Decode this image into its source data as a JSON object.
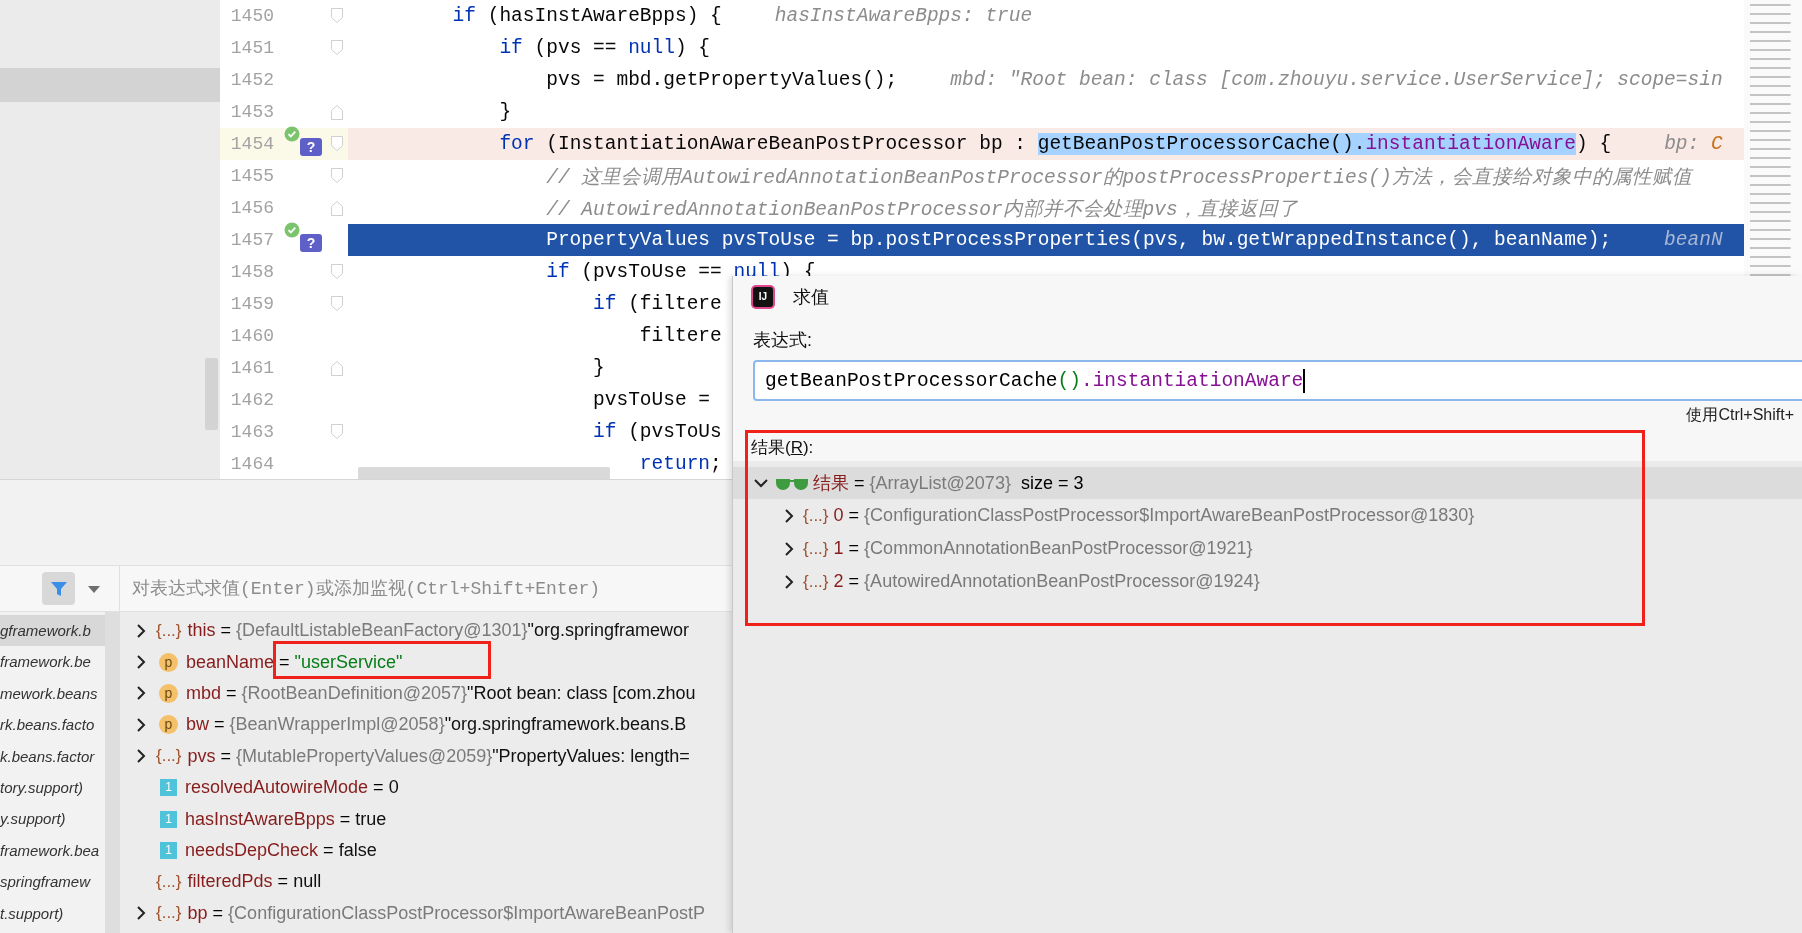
{
  "left_panel": {
    "rows": [
      {
        "selected": true
      }
    ]
  },
  "editor": {
    "lines": [
      {
        "number": "1450",
        "fold_open": true,
        "tokens": [
          {
            "kind": "kw",
            "text": "if"
          },
          {
            "kind": "plain",
            "text": " (hasInstAwareBpps) {"
          }
        ],
        "hint": [
          {
            "kind": "hint",
            "text": "hasInstAwareBpps: true"
          }
        ],
        "children": [
          {
            "number": "1451",
            "fold_open": true,
            "tokens": [
              {
                "kind": "kw",
                "text": "if"
              },
              {
                "kind": "plain",
                "text": " (pvs == "
              },
              {
                "kind": "kw",
                "text": "null"
              },
              {
                "kind": "plain",
                "text": ") {"
              }
            ],
            "children": [
              {
                "number": "1452",
                "tokens": [
                  {
                    "kind": "plain",
                    "text": "pvs = mbd.getPropertyValues();"
                  }
                ],
                "hint": [
                  {
                    "kind": "hint",
                    "text": "mbd: \"Root bean: class [com.zhouyu.service.UserService]; scope=sin"
                  }
                ]
              }
            ]
          },
          {
            "number": "1453",
            "fold_open": false,
            "tokens": [
              {
                "kind": "plain",
                "text": "}"
              }
            ]
          },
          {
            "number": "1454",
            "fold_open": true,
            "breakpoint": true,
            "current": false,
            "marker": "?",
            "tokens": [
              {
                "kind": "kw",
                "text": "for"
              },
              {
                "kind": "plain",
                "text": " (InstantiationAwareBeanPostProcessor bp : "
              },
              {
                "kind": "plain",
                "text": "getBeanPostProcessorCache().",
                "selected": true
              },
              {
                "kind": "field",
                "text": "instantiationAware",
                "selected": true
              },
              {
                "kind": "plain",
                "text": ") {"
              }
            ],
            "hint": [
              {
                "kind": "hint",
                "text": "bp: "
              },
              {
                "kind": "hint_ref",
                "text": "C"
              }
            ],
            "children": [
              {
                "number": "1455",
                "fold_open": true,
                "tokens": [
                  {
                    "kind": "comment",
                    "text": "// 这里会调用AutowiredAnnotationBeanPostProcessor的postProcessProperties()方法，会直接给对象中的属性赋值"
                  }
                ]
              },
              {
                "number": "1456",
                "fold_open": false,
                "tokens": [
                  {
                    "kind": "comment",
                    "text": "// AutowiredAnnotationBeanPostProcessor内部并不会处理pvs，直接返回了"
                  }
                ]
              },
              {
                "number": "1457",
                "breakpoint": true,
                "current": true,
                "marker": "?",
                "tokens": [
                  {
                    "kind": "plain",
                    "text": "PropertyValues pvsToUse = bp.postProcessProperties(pvs, bw.getWrappedInstance(), beanName);"
                  }
                ],
                "hint": [
                  {
                    "kind": "hint",
                    "text": "beanN"
                  }
                ]
              },
              {
                "number": "1458",
                "fold_open": true,
                "tokens": [
                  {
                    "kind": "kw",
                    "text": "if"
                  },
                  {
                    "kind": "plain",
                    "text": " (pvsToUse == "
                  },
                  {
                    "kind": "kw",
                    "text": "null"
                  },
                  {
                    "kind": "plain",
                    "text": ") {"
                  }
                ],
                "children": [
                  {
                    "number": "1459",
                    "fold_open": true,
                    "tokens": [
                      {
                        "kind": "kw",
                        "text": "if"
                      },
                      {
                        "kind": "plain",
                        "text": " (filtere"
                      }
                    ],
                    "children": [
                      {
                        "number": "1460",
                        "tokens": [
                          {
                            "kind": "plain",
                            "text": "filtere"
                          }
                        ]
                      }
                    ]
                  },
                  {
                    "number": "1461",
                    "fold_open": false,
                    "tokens": [
                      {
                        "kind": "plain",
                        "text": "}"
                      }
                    ]
                  },
                  {
                    "number": "1462",
                    "tokens": [
                      {
                        "kind": "plain",
                        "text": "pvsToUse ="
                      }
                    ]
                  },
                  {
                    "number": "1463",
                    "fold_open": true,
                    "tokens": [
                      {
                        "kind": "kw",
                        "text": "if"
                      },
                      {
                        "kind": "plain",
                        "text": " (pvsToUs"
                      }
                    ],
                    "children": [
                      {
                        "number": "1464",
                        "tokens": [
                          {
                            "kind": "kw",
                            "text": "return"
                          },
                          {
                            "kind": "plain",
                            "text": ";"
                          }
                        ]
                      }
                    ]
                  }
                ]
              }
            ]
          }
        ]
      }
    ]
  },
  "debugger": {
    "watch_placeholder": "对表达式求值(Enter)或添加监视(Ctrl+Shift+Enter)",
    "frames": [
      {
        "text": "gframework.b",
        "selected": true
      },
      {
        "text": "framework.be",
        "selected": false
      },
      {
        "text": "mework.beans",
        "selected": false
      },
      {
        "text": "rk.beans.facto",
        "selected": false
      },
      {
        "text": "k.beans.factor",
        "selected": false
      },
      {
        "text": "tory.support)",
        "selected": false
      },
      {
        "text": "y.support)",
        "selected": false
      },
      {
        "text": "framework.bea",
        "selected": false
      },
      {
        "text": "springframew",
        "selected": false
      },
      {
        "text": "t.support)",
        "selected": false
      }
    ],
    "variables": [
      {
        "kind": "object",
        "badge": "{...}",
        "expandable": true,
        "name": "this",
        "op": "=",
        "ref": "{DefaultListableBeanFactory@1301}",
        "value": "\"org.springframewor",
        "string": false
      },
      {
        "kind": "param",
        "badge": "p",
        "expandable": true,
        "name": "beanName",
        "op": "=",
        "value": "\"userService\"",
        "string": true
      },
      {
        "kind": "param",
        "badge": "p",
        "expandable": true,
        "name": "mbd",
        "op": "=",
        "ref": "{RootBeanDefinition@2057}",
        "value": "\"Root bean: class [com.zhou",
        "string": false
      },
      {
        "kind": "param",
        "badge": "p",
        "expandable": true,
        "name": "bw",
        "op": "=",
        "ref": "{BeanWrapperImpl@2058}",
        "value": "\"org.springframework.beans.B",
        "string": false
      },
      {
        "kind": "object",
        "badge": "{...}",
        "expandable": true,
        "name": "pvs",
        "op": "=",
        "ref": "{MutablePropertyValues@2059}",
        "value": "\"PropertyValues: length=",
        "string": false
      },
      {
        "kind": "primitive",
        "badge": "1",
        "expandable": false,
        "name": "resolvedAutowireMode",
        "op": "=",
        "value": "0",
        "string": false
      },
      {
        "kind": "primitive",
        "badge": "1",
        "expandable": false,
        "name": "hasInstAwareBpps",
        "op": "=",
        "value": "true",
        "string": false
      },
      {
        "kind": "primitive",
        "badge": "1",
        "expandable": false,
        "name": "needsDepCheck",
        "op": "=",
        "value": "false",
        "string": false
      },
      {
        "kind": "object",
        "badge": "{...}",
        "expandable": false,
        "name": "filteredPds",
        "op": "=",
        "value": "null",
        "string": false
      },
      {
        "kind": "object",
        "badge": "{...}",
        "expandable": true,
        "name": "bp",
        "op": "=",
        "ref": "{ConfigurationClassPostProcessor$ImportAwareBeanPostP"
      }
    ]
  },
  "dialog": {
    "logo": "IJ",
    "title": "求值",
    "expression_label": "表达式:",
    "expression": [
      {
        "kind": "plain",
        "text": "getBeanPostProcessorCache"
      },
      {
        "kind": "paren",
        "text": "()"
      },
      {
        "kind": "field",
        "text": ".instantiationAware"
      }
    ],
    "shortcut_hint": "使用Ctrl+Shift+",
    "result_label": {
      "before": "结果(",
      "mnemonic": "R",
      "after": "):"
    },
    "result": {
      "name": "结果",
      "op": "=",
      "ref": "{ArrayList@2073}",
      "extra": "size = 3",
      "expanded": true,
      "selected": true,
      "children": [
        {
          "badge": "{...}",
          "name": "0",
          "op": "=",
          "ref": "{ConfigurationClassPostProcessor$ImportAwareBeanPostProcessor@1830}",
          "expanded": false
        },
        {
          "badge": "{...}",
          "name": "1",
          "op": "=",
          "ref": "{CommonAnnotationBeanPostProcessor@1921}",
          "expanded": false
        },
        {
          "badge": "{...}",
          "name": "2",
          "op": "=",
          "ref": "{AutowiredAnnotationBeanPostProcessor@1924}",
          "expanded": false
        }
      ]
    }
  }
}
